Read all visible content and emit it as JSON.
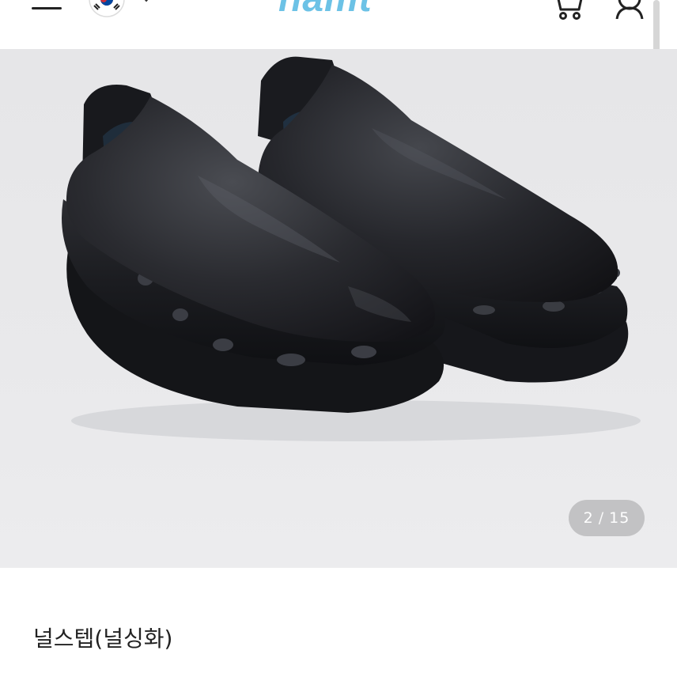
{
  "header": {
    "logo_text": "namt",
    "menu_icon": "hamburger-menu-icon",
    "flag_icon": "korea-flag-icon",
    "language_chevron_icon": "chevron-down-icon",
    "cart_icon": "cart-icon",
    "user_icon": "user-icon",
    "brand_color": "#6cc2e6"
  },
  "gallery": {
    "current": "2",
    "separator": "/",
    "total": "15",
    "image_subject": "black slip-on clog shoes"
  },
  "product": {
    "title": "널스텝(널싱화)"
  }
}
